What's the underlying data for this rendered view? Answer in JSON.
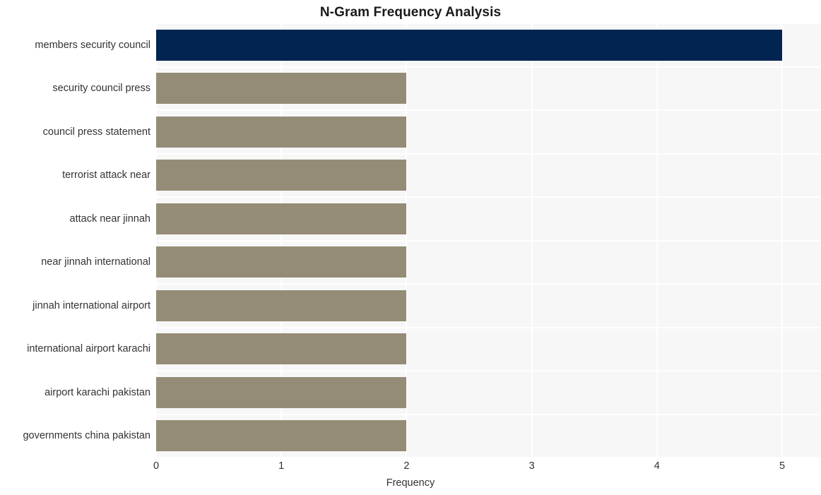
{
  "chart_data": {
    "type": "bar",
    "orientation": "horizontal",
    "title": "N-Gram Frequency Analysis",
    "xlabel": "Frequency",
    "ylabel": "",
    "categories": [
      "members security council",
      "security council press",
      "council press statement",
      "terrorist attack near",
      "attack near jinnah",
      "near jinnah international",
      "jinnah international airport",
      "international airport karachi",
      "airport karachi pakistan",
      "governments china pakistan"
    ],
    "values": [
      5,
      2,
      2,
      2,
      2,
      2,
      2,
      2,
      2,
      2
    ],
    "bar_colors": [
      "#022451",
      "#948c76",
      "#948c76",
      "#948c76",
      "#948c76",
      "#948c76",
      "#948c76",
      "#948c76",
      "#948c76",
      "#948c76"
    ],
    "xlim": [
      0,
      5.31
    ],
    "xticks": [
      0,
      1,
      2,
      3,
      4,
      5
    ],
    "xtick_labels": [
      "0",
      "1",
      "2",
      "3",
      "4",
      "5"
    ],
    "grid": true,
    "grid_color": "#ffffff",
    "plot_background": "#f7f7f7",
    "figure_background": "#ffffff",
    "legend": null,
    "legend_position": "none"
  },
  "colors": {
    "highlight_bar": "#022451",
    "default_bar": "#948c76",
    "title_text": "#1a1a1a",
    "tick_text": "#333333",
    "plot_bg": "#f7f7f7",
    "grid": "#ffffff"
  }
}
